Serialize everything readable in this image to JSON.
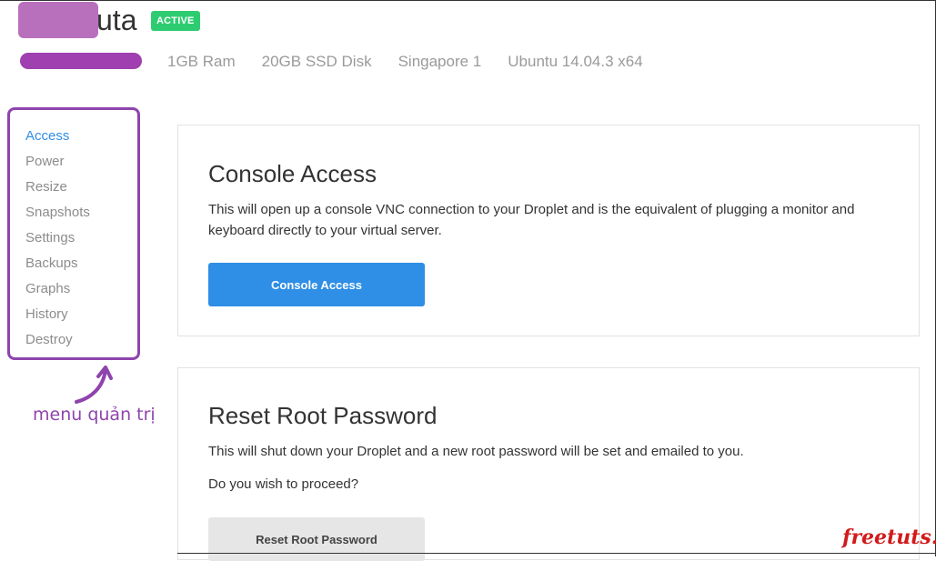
{
  "droplet": {
    "name_suffix": "uta",
    "status": "ACTIVE"
  },
  "specs": [
    "1GB Ram",
    "20GB SSD Disk",
    "Singapore 1",
    "Ubuntu 14.04.3 x64"
  ],
  "sidebar": {
    "items": [
      {
        "label": "Access",
        "active": true
      },
      {
        "label": "Power"
      },
      {
        "label": "Resize"
      },
      {
        "label": "Snapshots"
      },
      {
        "label": "Settings"
      },
      {
        "label": "Backups"
      },
      {
        "label": "Graphs"
      },
      {
        "label": "History"
      },
      {
        "label": "Destroy"
      }
    ]
  },
  "annotation": {
    "text": "menu quản trị",
    "color": "#8e44ad"
  },
  "console": {
    "title": "Console Access",
    "description": "This will open up a console VNC connection to your Droplet and is the equivalent of plugging a monitor and keyboard directly to your virtual server.",
    "button_label": "Console Access"
  },
  "reset": {
    "title": "Reset Root Password",
    "description": "This will shut down your Droplet and a new root password will be set and emailed to you.",
    "question": "Do you wish to proceed?",
    "button_label": "Reset Root Password"
  },
  "watermark": "freetuts.net",
  "colors": {
    "accent": "#2f8ee5",
    "active_badge": "#2ecc71",
    "annotation": "#8e44ad"
  }
}
